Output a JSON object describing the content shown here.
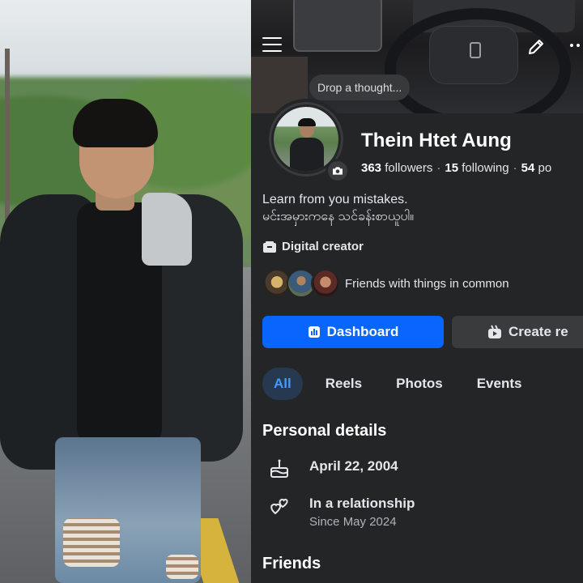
{
  "header": {
    "thought_placeholder": "Drop a thought..."
  },
  "profile": {
    "name": "Thein Htet Aung",
    "followers_count": "363",
    "followers_label": "followers",
    "following_count": "15",
    "following_label": "following",
    "posts_count": "54",
    "posts_label": "po",
    "bio_line1": "Learn from you mistakes.",
    "bio_line2": "မင်းအမှားကနေ သင်ခန်းစာယူပါ။",
    "category": "Digital creator",
    "mutual_text": "Friends with things in common"
  },
  "actions": {
    "dashboard_label": "Dashboard",
    "create_label": "Create re"
  },
  "tabs": [
    {
      "label": "All",
      "active": true
    },
    {
      "label": "Reels",
      "active": false
    },
    {
      "label": "Photos",
      "active": false
    },
    {
      "label": "Events",
      "active": false
    }
  ],
  "personal_details": {
    "title": "Personal details",
    "birthday": "April 22, 2004",
    "relationship": "In a relationship",
    "relationship_since": "Since May 2024"
  },
  "friends": {
    "title": "Friends"
  },
  "colors": {
    "accent": "#0866ff",
    "background": "#242526",
    "tab_active_bg": "#263951",
    "tab_active_text": "#4599ff"
  },
  "icons": [
    "menu-icon",
    "edit-icon",
    "more-icon",
    "camera-icon",
    "category-icon",
    "dashboard-icon",
    "create-icon",
    "birthday-icon",
    "relationship-icon"
  ]
}
